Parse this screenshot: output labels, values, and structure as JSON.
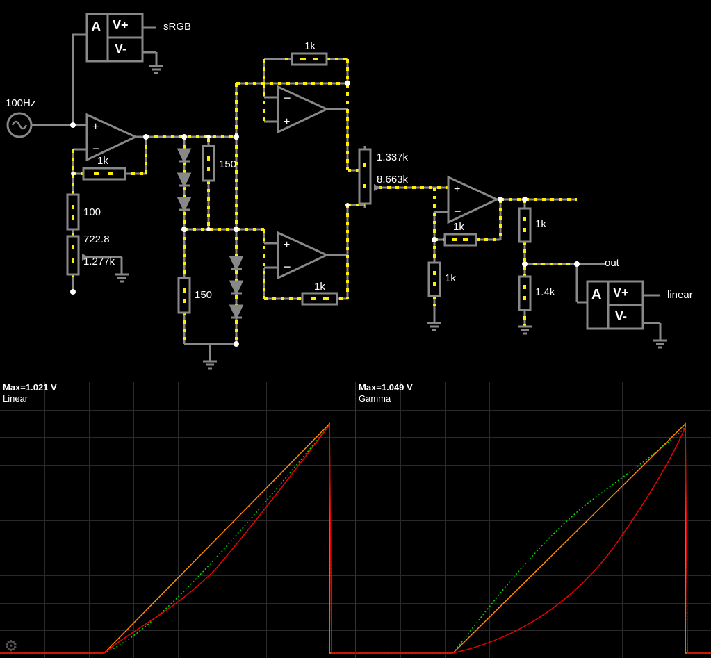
{
  "schematic": {
    "source_freq": "100Hz",
    "ammeter1_A": "A",
    "ammeter1_Vplus": "V+",
    "ammeter1_Vminus": "V-",
    "ammeter1_label": "sRGB",
    "ammeter2_A": "A",
    "ammeter2_Vplus": "V+",
    "ammeter2_Vminus": "V-",
    "ammeter2_label": "linear",
    "r_1k_a": "1k",
    "r_1k_b": "1k",
    "r_1k_c": "1k",
    "r_1k_d": "1k",
    "r_1k_e": "1k",
    "r_1k_f": "1k",
    "r_100": "100",
    "r_150_a": "150",
    "r_150_b": "150",
    "r_1p4k": "1.4k",
    "pot1_top": "722.8",
    "pot1_bot": "1.277k",
    "pot2_top": "1.337k",
    "pot2_bot": "8.663k",
    "out_label": "out"
  },
  "plots": {
    "left": {
      "max": "Max=1.021 V",
      "name": "Linear"
    },
    "right": {
      "max": "Max=1.049 V",
      "name": "Gamma"
    }
  },
  "gear_icon": "⚙"
}
